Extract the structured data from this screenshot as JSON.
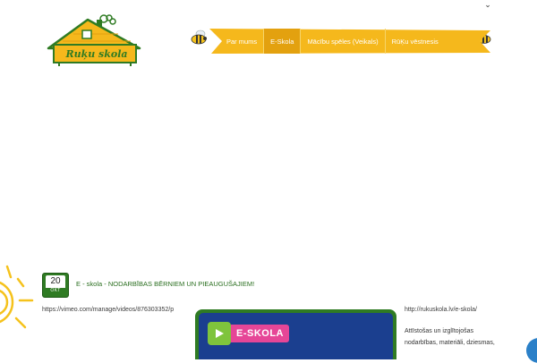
{
  "header": {
    "logo_text": "Ruķu skola",
    "nav_items": [
      {
        "label": "Par mums",
        "active": false
      },
      {
        "label": "E-Skola",
        "active": true
      },
      {
        "label": "Mācību spēles (Veikals)",
        "active": false
      },
      {
        "label": "RūĶu vēstnesis",
        "active": false
      }
    ]
  },
  "post": {
    "date_day": "20",
    "date_month": "OKT",
    "title": "E - skola - NODARBĪBAS BĒRNIEM UN PIEAUGUŠAJIEM!"
  },
  "content": {
    "video_link": "https://vimeo.com/manage/videos/876303352/p",
    "site_link": "http://rukuskola.lv/e-skola/",
    "video_badge": "E-SKOLA",
    "description_lines": [
      "Attīstošas un izglītojošas",
      "nodarbības, materiāli, dziesmas,"
    ]
  },
  "colors": {
    "nav_yellow": "#f5b81c",
    "nav_active": "#e3a10f",
    "green": "#2f7b23",
    "video_blue": "#1b3f8f",
    "badge_pink": "#e64697",
    "play_green": "#7fc43c"
  }
}
